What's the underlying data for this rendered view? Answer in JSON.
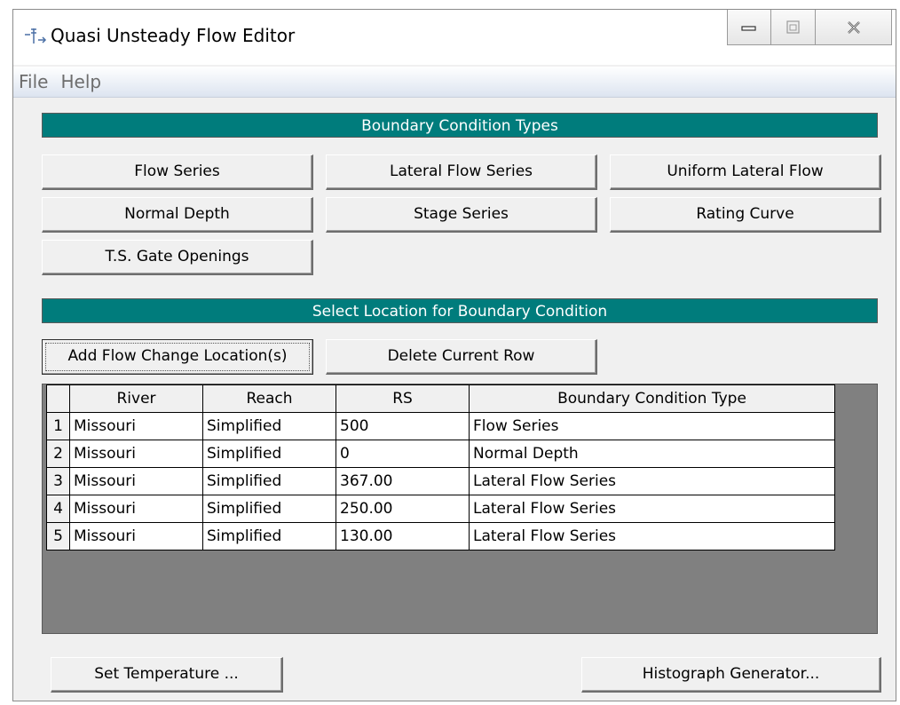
{
  "window": {
    "title": "Quasi Unsteady Flow Editor",
    "icon": "hec-ras-flow-icon"
  },
  "menu": {
    "items": [
      {
        "label": "File"
      },
      {
        "label": "Help"
      }
    ]
  },
  "boundary_types": {
    "header": "Boundary Condition Types",
    "buttons": [
      {
        "label": "Flow Series"
      },
      {
        "label": "Lateral Flow Series"
      },
      {
        "label": "Uniform Lateral Flow"
      },
      {
        "label": "Normal Depth"
      },
      {
        "label": "Stage Series"
      },
      {
        "label": "Rating Curve"
      },
      {
        "label": "T.S. Gate Openings"
      }
    ]
  },
  "location": {
    "header": "Select Location for Boundary Condition",
    "add_button": "Add Flow Change Location(s)",
    "delete_button": "Delete Current Row"
  },
  "table": {
    "columns": [
      "River",
      "Reach",
      "RS",
      "Boundary Condition Type"
    ],
    "rows": [
      {
        "num": "1",
        "river": "Missouri",
        "reach": "Simplified",
        "rs": "500",
        "bc_type": "Flow Series"
      },
      {
        "num": "2",
        "river": "Missouri",
        "reach": "Simplified",
        "rs": "0",
        "bc_type": "Normal Depth"
      },
      {
        "num": "3",
        "river": "Missouri",
        "reach": "Simplified",
        "rs": "367.00",
        "bc_type": "Lateral Flow Series"
      },
      {
        "num": "4",
        "river": "Missouri",
        "reach": "Simplified",
        "rs": "250.00",
        "bc_type": "Lateral Flow Series"
      },
      {
        "num": "5",
        "river": "Missouri",
        "reach": "Simplified",
        "rs": "130.00",
        "bc_type": "Lateral Flow Series"
      }
    ]
  },
  "footer": {
    "temperature_button": "Set Temperature ...",
    "histograph_button": "Histograph Generator..."
  },
  "colors": {
    "banner": "#007c7c",
    "grid_background": "#808080",
    "window_background": "#f0f0f0"
  }
}
